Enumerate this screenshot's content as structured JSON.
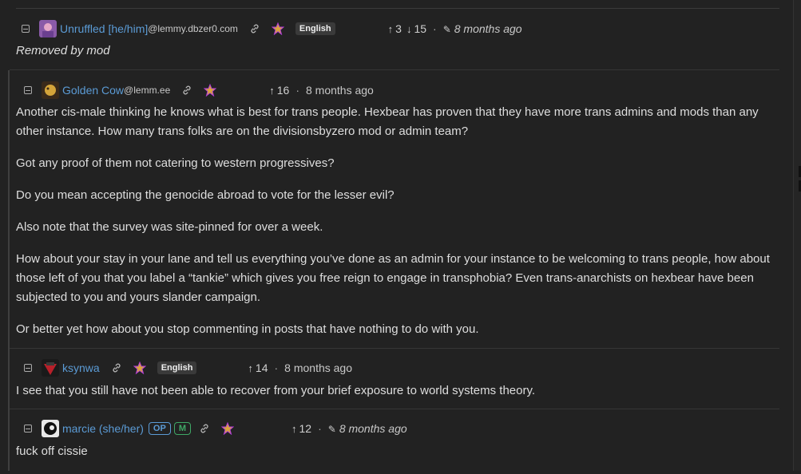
{
  "comments": [
    {
      "user": "Unruffled [he/him]",
      "instance": "@lemmy.dbzer0.com",
      "language": "English",
      "upvotes": "3",
      "downvotes": "15",
      "time": "8 months ago",
      "body": [
        "Removed by mod"
      ]
    },
    {
      "user": "Golden Cow",
      "instance": "@lemm.ee",
      "upvotes": "16",
      "time": "8 months ago",
      "body": [
        "Another cis-male thinking he knows what is best for trans people. Hexbear has proven that they have more trans admins and mods than any other instance. How many trans folks are on the divisionsbyzero mod or admin team?",
        "Got any proof of them not catering to western progressives?",
        "Do you mean accepting the genocide abroad to vote for the lesser evil?",
        "Also note that the survey was site-pinned for over a week.",
        "How about your stay in your lane and tell us everything you’ve done as an admin for your instance to be welcoming to trans people, how about those left of you that you label a “tankie” which gives you free reign to engage in transphobia? Even trans-anarchists on hexbear have been subjected to you and yours slander campaign.",
        "Or better yet how about you stop commenting in posts that have nothing to do with you."
      ]
    },
    {
      "user": "ksynwa",
      "language": "English",
      "upvotes": "14",
      "time": "8 months ago",
      "body": [
        "I see that you still have not been able to recover from your brief exposure to world systems theory."
      ]
    },
    {
      "user": "marcie (she/her)",
      "badge_op": "OP",
      "badge_m": "M",
      "upvotes": "12",
      "time": "8 months ago",
      "body": [
        "fuck off cissie"
      ]
    }
  ],
  "icons": {
    "collapse": "minus-square-icon",
    "link": "link-icon",
    "star": "star-icon",
    "upvote": "arrow-up-icon",
    "downvote": "arrow-down-icon",
    "edit": "pencil-icon"
  },
  "colors": {
    "background": "#222222",
    "username": "#5b9bd5",
    "op_badge": "#5b9bd5",
    "mod_badge": "#3fa866"
  }
}
